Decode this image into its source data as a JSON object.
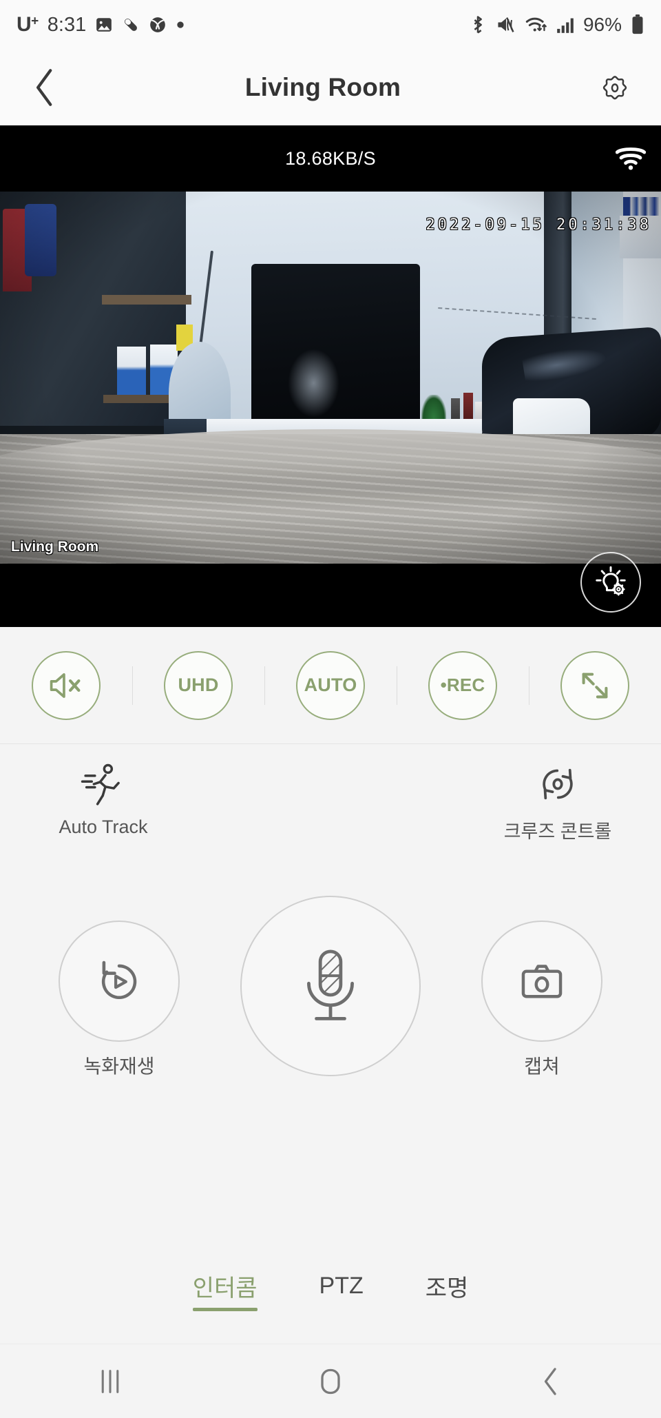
{
  "status_bar": {
    "carrier": "U",
    "carrier_sup": "+",
    "time": "8:31",
    "battery_percent": "96%",
    "left_icons": [
      "gallery-icon",
      "pill-icon",
      "tennis-ball-icon",
      "dot-icon"
    ],
    "right_icons": [
      "bluetooth-icon",
      "mute-vibrate-icon",
      "wifi-transfer-icon",
      "cellular-signal-icon",
      "battery-icon"
    ]
  },
  "header": {
    "back_label": "back-chevron",
    "title": "Living Room",
    "settings_label": "settings-gear"
  },
  "video": {
    "bitrate": "18.68KB/S",
    "wifi_icon": "wifi-icon",
    "timestamp": "2022-09-15  20:31:38",
    "camera_label": "Living Room",
    "light_button_icon": "light-bulb-settings-icon"
  },
  "quick_controls": [
    {
      "name": "mute",
      "type": "icon",
      "icon": "speaker-mute-icon",
      "label": ""
    },
    {
      "name": "resolution",
      "type": "text",
      "icon": "",
      "label": "UHD"
    },
    {
      "name": "auto-mode",
      "type": "text",
      "icon": "",
      "label": "AUTO"
    },
    {
      "name": "record",
      "type": "text",
      "icon": "",
      "label": "•REC"
    },
    {
      "name": "fullscreen",
      "type": "icon",
      "icon": "expand-arrows-icon",
      "label": ""
    }
  ],
  "features": [
    {
      "name": "auto-track",
      "icon": "running-person-icon",
      "label": "Auto Track"
    },
    {
      "name": "cruise-control",
      "icon": "rotate-camera-icon",
      "label": "크루즈 콘트롤"
    }
  ],
  "actions": [
    {
      "name": "playback",
      "icon": "replay-play-icon",
      "label": "녹화재생"
    },
    {
      "name": "intercom-mic",
      "icon": "microphone-icon",
      "label": ""
    },
    {
      "name": "capture",
      "icon": "camera-icon",
      "label": "캡쳐"
    }
  ],
  "tabs": [
    {
      "name": "intercom",
      "label": "인터콤",
      "active": true
    },
    {
      "name": "ptz",
      "label": "PTZ",
      "active": false
    },
    {
      "name": "lighting",
      "label": "조명",
      "active": false
    }
  ],
  "nav_bar": [
    "recents-icon",
    "home-icon",
    "back-icon"
  ],
  "colors": {
    "accent_green": "#8aa06e",
    "accent_green_border": "#97ad7c",
    "text_primary": "#333333",
    "text_secondary": "#555555",
    "page_background": "#f4f4f4",
    "video_background": "#000000"
  }
}
